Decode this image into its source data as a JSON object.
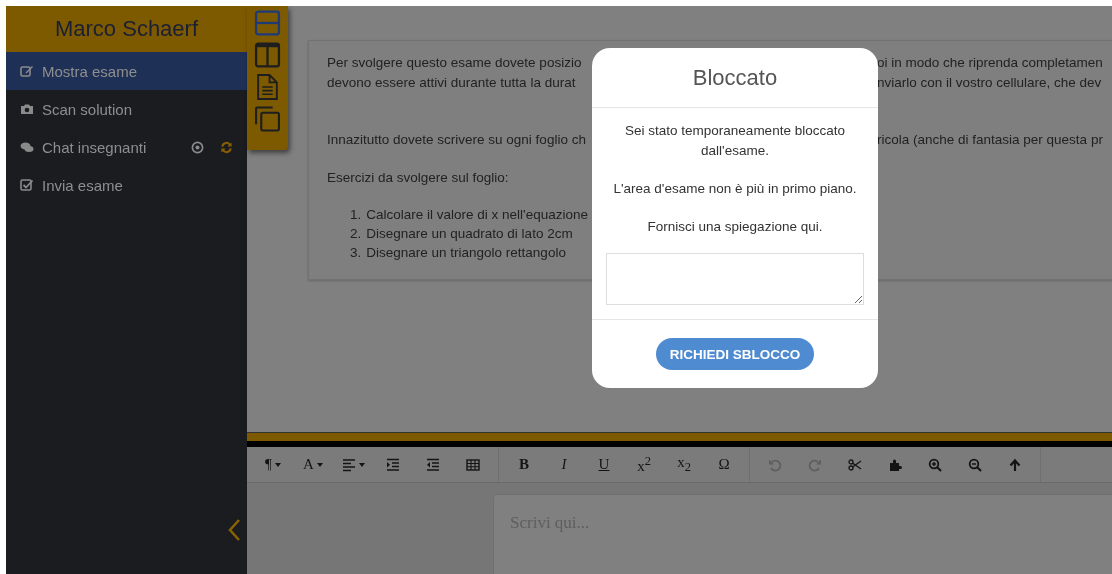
{
  "sidebar": {
    "title": "Marco Schaerf",
    "items": [
      {
        "kind": "edit",
        "label": "Mostra esame",
        "selected": true
      },
      {
        "kind": "camera",
        "label": "Scan solution",
        "selected": false
      },
      {
        "kind": "chat",
        "label": "Chat insegnanti",
        "selected": false
      },
      {
        "kind": "check",
        "label": "Invia esame",
        "selected": false
      }
    ]
  },
  "layout_palette": [
    {
      "kind": "rows",
      "selected": true
    },
    {
      "kind": "columns",
      "selected": false
    },
    {
      "kind": "document",
      "selected": false
    },
    {
      "kind": "copy",
      "selected": false
    }
  ],
  "exam": {
    "lines": [
      {
        "left": "Per svolgere questo esame dovete posizio",
        "right": "oi in modo che riprenda completamen"
      },
      {
        "left": "devono essere attivi durante tutta la durat",
        "right": "nviarlo con il vostro cellulare, che dev"
      },
      {
        "left": "Innazitutto dovete scrivere su ogni foglio ch",
        "right": "ricola (anche di fantasia per questa pr"
      },
      {
        "left": "Esercizi da svolgere sul foglio:"
      }
    ],
    "exercises": [
      {
        "number": "1.",
        "text": "Calcolare il valore di x nell'equazione"
      },
      {
        "number": "2.",
        "text": "Disegnare un quadrato di lato 2cm"
      },
      {
        "number": "3.",
        "text": "Disegnare un triangolo rettangolo"
      }
    ]
  },
  "toolbar": [
    [
      {
        "kind": "text",
        "label": "¶",
        "dropdown": true,
        "disabled": false
      },
      {
        "kind": "text",
        "label": "A",
        "dropdown": true,
        "disabled": false
      },
      {
        "kind": "align",
        "dropdown": true,
        "disabled": false
      },
      {
        "kind": "indent",
        "disabled": false
      },
      {
        "kind": "outdent",
        "disabled": false
      },
      {
        "kind": "table",
        "disabled": false
      }
    ],
    [
      {
        "kind": "bold",
        "label": "B",
        "disabled": false
      },
      {
        "kind": "italic",
        "label": "I",
        "disabled": false
      },
      {
        "kind": "underline",
        "label": "U",
        "disabled": false
      },
      {
        "kind": "text",
        "label": "x$^{2}$",
        "disabled": false
      },
      {
        "kind": "text",
        "label": "x$_{2}$",
        "disabled": false
      },
      {
        "kind": "text",
        "label": "Ω",
        "disabled": false
      }
    ],
    [
      {
        "kind": "undo",
        "disabled": true
      },
      {
        "kind": "redo",
        "disabled": true
      },
      {
        "kind": "scissors",
        "disabled": false
      },
      {
        "kind": "puzzle",
        "disabled": false
      },
      {
        "kind": "zoom-in",
        "disabled": false
      },
      {
        "kind": "zoom-out",
        "disabled": false
      },
      {
        "kind": "up",
        "disabled": false
      }
    ]
  ],
  "editor": {
    "placeholder": "Scrivi qui..."
  },
  "modal": {
    "title": "Bloccato",
    "messages": [
      "Sei stato temporaneamente bloccato dall'esame.",
      "L'area d'esame non è più in primo piano.",
      "Fornisci una spiegazione qui."
    ],
    "button": "RICHIEDI SBLOCCO"
  }
}
